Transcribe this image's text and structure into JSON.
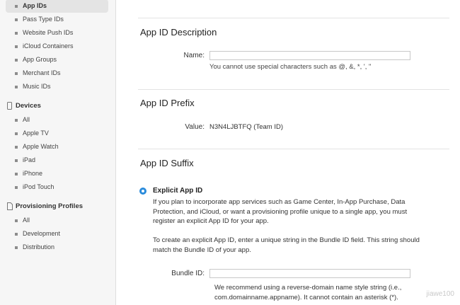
{
  "sidebar": {
    "identifiers_items": [
      {
        "label": "App IDs",
        "active": true
      },
      {
        "label": "Pass Type IDs"
      },
      {
        "label": "Website Push IDs"
      },
      {
        "label": "iCloud Containers"
      },
      {
        "label": "App Groups"
      },
      {
        "label": "Merchant IDs"
      },
      {
        "label": "Music IDs"
      }
    ],
    "devices_title": "Devices",
    "devices_items": [
      "All",
      "Apple TV",
      "Apple Watch",
      "iPad",
      "iPhone",
      "iPod Touch"
    ],
    "profiles_title": "Provisioning Profiles",
    "profiles_items": [
      "All",
      "Development",
      "Distribution"
    ]
  },
  "description": {
    "heading": "App ID Description",
    "name_label": "Name:",
    "name_value": "",
    "name_hint": "You cannot use special characters such as @, &, *, ', \""
  },
  "prefix": {
    "heading": "App ID Prefix",
    "value_label": "Value:",
    "value": "N3N4LJBTFQ (Team ID)"
  },
  "suffix": {
    "heading": "App ID Suffix",
    "explicit_label": "Explicit App ID",
    "explicit_para1": "If you plan to incorporate app services such as Game Center, In-App Purchase, Data Protection, and iCloud, or want a provisioning profile unique to a single app, you must register an explicit App ID for your app.",
    "explicit_para2": "To create an explicit App ID, enter a unique string in the Bundle ID field. This string should match the Bundle ID of your app.",
    "bundle_label": "Bundle ID:",
    "bundle_value": "",
    "bundle_hint": "We recommend using a reverse-domain name style string (i.e., com.domainname.appname). It cannot contain an asterisk (*)."
  },
  "watermark": "jiawe100"
}
